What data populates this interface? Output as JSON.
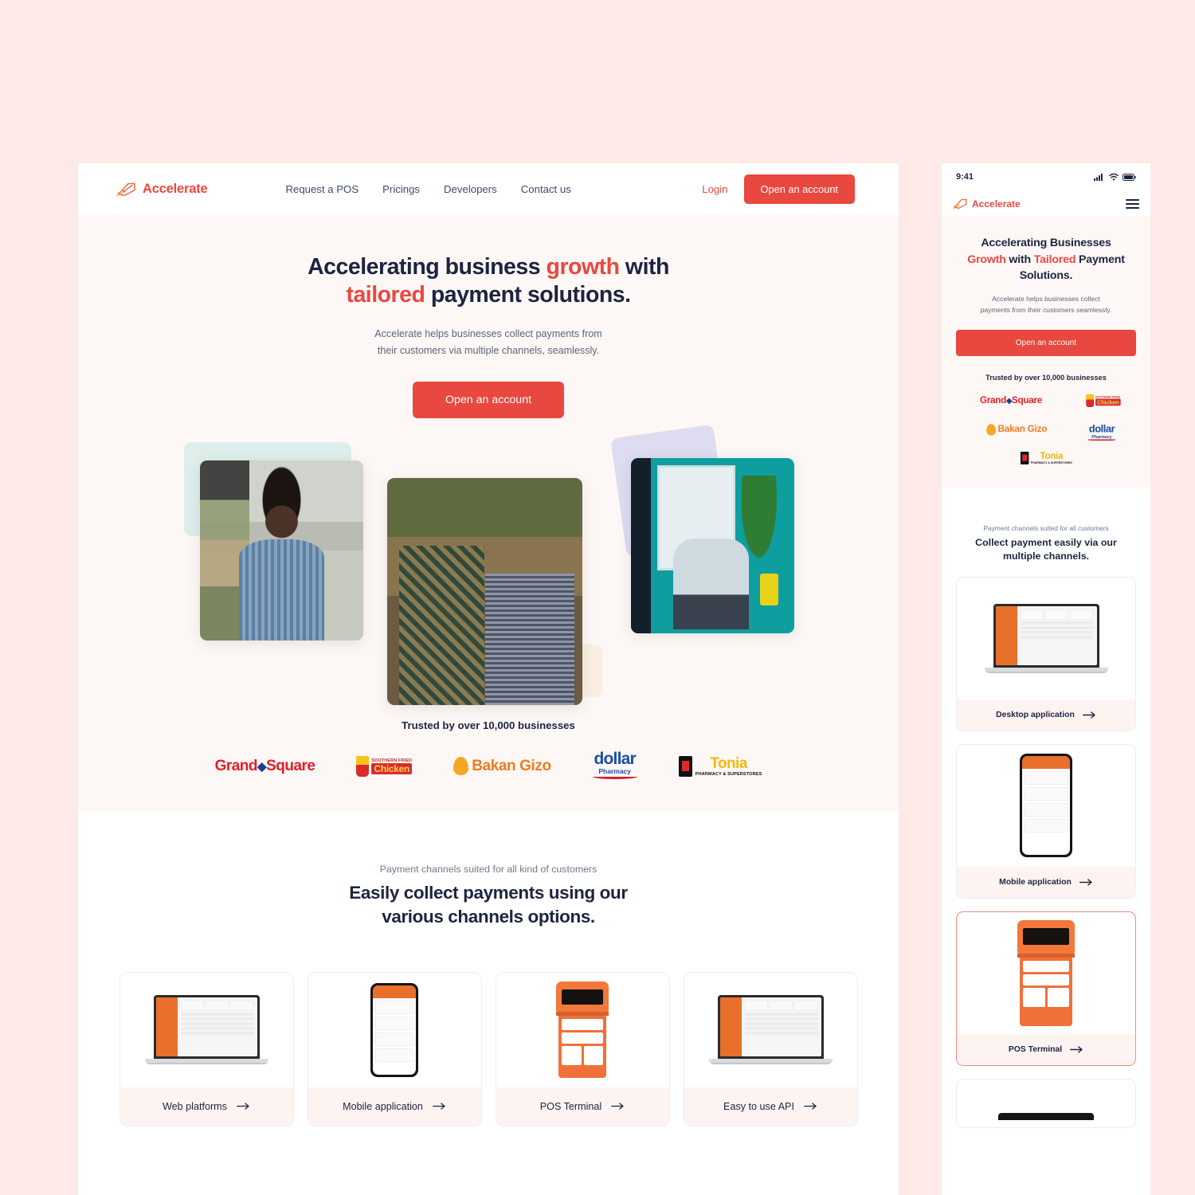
{
  "theme": {
    "page_bg": "#fde9e6",
    "accent": "#e8483f",
    "ink": "#1d2440",
    "muted": "#5c6479",
    "hero_bg": "#fdf8f6",
    "card_foot_bg": "#fdf4f2"
  },
  "desktop": {
    "nav": {
      "brand": "Accelerate",
      "links": [
        "Request a POS",
        "Pricings",
        "Developers",
        "Contact us"
      ],
      "login_label": "Login",
      "cta_label": "Open an account"
    },
    "hero": {
      "title_part1": "Accelerating business ",
      "title_highlight1": "growth",
      "title_part2": " with",
      "title_highlight2": "tailored",
      "title_part3": " payment solutions.",
      "subtitle_line1": "Accelerate helps businesses collect payments from",
      "subtitle_line2": "their customers via multiple channels, seamlessly.",
      "cta_label": "Open an account"
    },
    "trusted": {
      "title": "Trusted by over 10,000 businesses",
      "logos": [
        {
          "name": "Grand Square",
          "word1": "Grand",
          "word2": "Square"
        },
        {
          "name": "Southern Fried Chicken",
          "top": "SOUTHERN FRIED",
          "mid": "Chicken"
        },
        {
          "name": "Bakan Gizo",
          "text": "Bakan Gizo"
        },
        {
          "name": "dollar Pharmacy",
          "top": "dollar",
          "bottom": "Pharmacy"
        },
        {
          "name": "Tonia Pharmacy & Superstores",
          "top": "Tonia",
          "bottom": "PHARMACY & SUPERSTORES"
        }
      ]
    },
    "channels": {
      "eyebrow": "Payment channels suited for all  kind of customers",
      "title_line1": "Easily collect payments using our",
      "title_line2": "various channels options.",
      "cards": [
        {
          "label": "Web platforms",
          "media": "laptop"
        },
        {
          "label": "Mobile application",
          "media": "phone"
        },
        {
          "label": "POS Terminal",
          "media": "pos"
        },
        {
          "label": "Easy to use API",
          "media": "laptop"
        }
      ]
    }
  },
  "mobile": {
    "status": {
      "time": "9:41",
      "signal_icon": "signal-icon",
      "wifi_icon": "wifi-icon",
      "battery_icon": "battery-icon"
    },
    "nav": {
      "brand": "Accelerate",
      "menu_icon": "hamburger-menu-icon"
    },
    "hero": {
      "title_part1": "Accelerating Businesses",
      "title_highlight1": "Growth",
      "title_mid": " with ",
      "title_highlight2": "Tailored",
      "title_part2": " Payment Solutions.",
      "subtitle_line1": "Accelerate helps businesses collect",
      "subtitle_line2": "payments from their customers seamlessly.",
      "cta_label": "Open an account"
    },
    "trusted": {
      "title": "Trusted by over 10,000 businesses"
    },
    "channels": {
      "eyebrow": "Payment channels suited for all customers",
      "title_line1": "Collect payment easily via our",
      "title_line2": "multiple channels.",
      "cards": [
        {
          "label": "Desktop application",
          "media": "laptop",
          "active": false
        },
        {
          "label": "Mobile application",
          "media": "phone",
          "active": false
        },
        {
          "label": "POS Terminal",
          "media": "pos",
          "active": true
        }
      ]
    }
  }
}
